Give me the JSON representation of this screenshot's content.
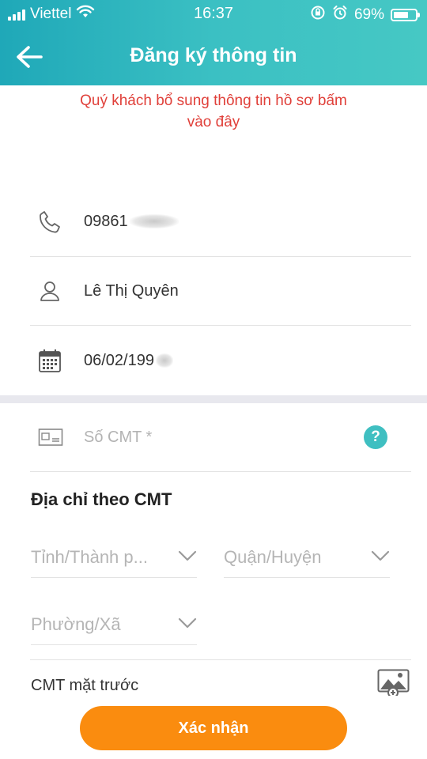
{
  "status_bar": {
    "carrier": "Viettel",
    "time": "16:37",
    "battery_percent": "69%",
    "battery_level": 0.69
  },
  "header": {
    "title": "Đăng ký thông tin"
  },
  "notice": {
    "line1": "Quý khách bổ sung thông tin hồ sơ bấm",
    "line2": "vào đây"
  },
  "profile": {
    "phone": "09861",
    "name": "Lê Thị Quyên",
    "dob": "06/02/199"
  },
  "id_field": {
    "placeholder": "Số CMT *",
    "help_label": "?"
  },
  "address": {
    "title": "Địa chỉ theo CMT",
    "province_placeholder": "Tỉnh/Thành p...",
    "district_placeholder": "Quận/Huyện",
    "ward_placeholder": "Phường/Xã"
  },
  "id_front": {
    "label": "CMT mặt trước"
  },
  "actions": {
    "confirm_label": "Xác nhận"
  },
  "colors": {
    "header_teal": "#3bc0c3",
    "notice_red": "#e0403a",
    "confirm_orange": "#fa8c0f"
  },
  "icons": [
    "wifi-icon",
    "rotation-lock-icon",
    "alarm-icon",
    "back-arrow-icon",
    "phone-icon",
    "user-icon",
    "calendar-icon",
    "id-card-icon",
    "help-icon",
    "chevron-down-icon",
    "image-add-icon"
  ]
}
